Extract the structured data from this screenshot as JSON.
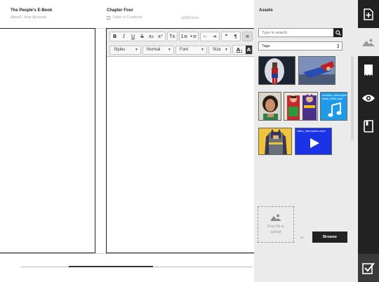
{
  "book": {
    "title": "The People's E-Book",
    "link_about": "About",
    "separator": " | ",
    "link_account": "Your Account"
  },
  "chapter": {
    "title": "Chapter Four",
    "toc_label": "Table of Contents",
    "filename": "a0068.html"
  },
  "editor": {
    "toolbar_row1": [
      "B",
      "I",
      "U",
      "S",
      "x₂",
      "x²",
      "Tx",
      "1≡",
      "•≡",
      "⇤",
      "⇥",
      "❞",
      "¶",
      "≡"
    ],
    "styles_label": "Styles",
    "format_label": "Normal",
    "font_label": "Font",
    "size_label": "Size",
    "text_color_label": "A",
    "bg_color_label": "A"
  },
  "assets": {
    "title": "Assets",
    "search_placeholder": "Type to search",
    "tags_label": "Tags",
    "thumbnails": [
      {
        "name": "wonder-woman-thumbnail",
        "caption": ""
      },
      {
        "name": "superman-thumbnail",
        "caption": ""
      },
      {
        "name": "woman-portrait-thumbnail",
        "caption": ""
      },
      {
        "name": "batgirl-robin-thumbnail",
        "caption": ""
      },
      {
        "name": "audio-file-thumbnail",
        "caption": "doubles_interruptc6 earth_8000.mp3"
      },
      {
        "name": "batman-thumbnail",
        "caption": ""
      },
      {
        "name": "video-file-thumbnail",
        "caption": "video_interruption.mp4"
      }
    ],
    "drop_text": "Drop file to upload",
    "or_label": "or",
    "browse_label": "Browse"
  },
  "iconbar": {
    "icons": [
      "add-page-icon",
      "image-assets-icon",
      "bookmark-icon",
      "preview-eye-icon",
      "book-icon",
      "publish-check-icon"
    ],
    "active": "image-assets-icon"
  },
  "colors": {
    "dark": "#222222",
    "panel": "#ebebeb",
    "audio_blue": "#1e9be8",
    "video_blue": "#1a33e6"
  }
}
